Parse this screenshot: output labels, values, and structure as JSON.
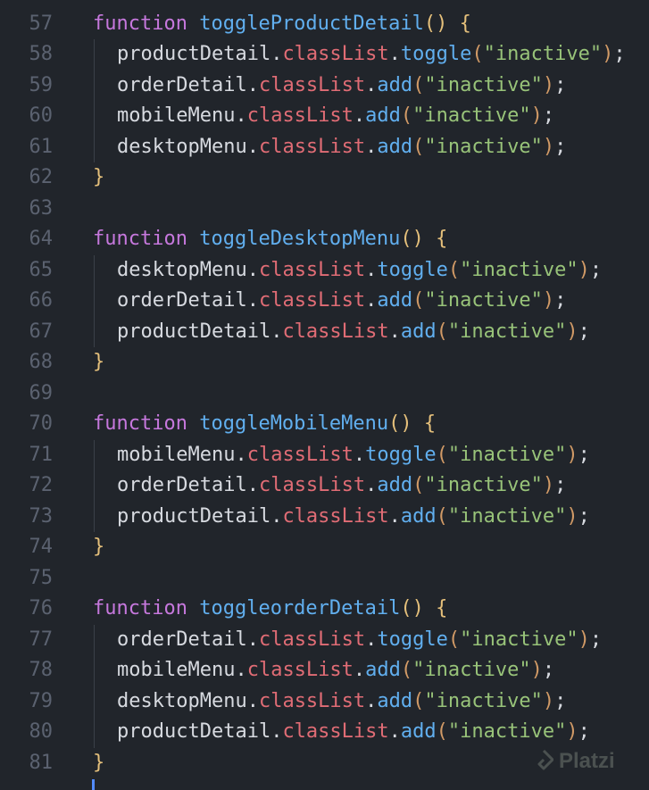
{
  "editor": {
    "lines": [
      {
        "n": "57",
        "indent": false,
        "tokens": [
          {
            "t": "kw",
            "v": "function"
          },
          {
            "t": "sp",
            "v": " "
          },
          {
            "t": "fn",
            "v": "toggleProductDetail"
          },
          {
            "t": "p1",
            "v": "()"
          },
          {
            "t": "sp",
            "v": " "
          },
          {
            "t": "p1",
            "v": "{"
          }
        ]
      },
      {
        "n": "58",
        "indent": true,
        "tokens": [
          {
            "t": "obj",
            "v": "productDetail"
          },
          {
            "t": "obj",
            "v": "."
          },
          {
            "t": "prop",
            "v": "classList"
          },
          {
            "t": "obj",
            "v": "."
          },
          {
            "t": "fn",
            "v": "toggle"
          },
          {
            "t": "p2",
            "v": "("
          },
          {
            "t": "str",
            "v": "\"inactive\""
          },
          {
            "t": "p2",
            "v": ")"
          },
          {
            "t": "obj",
            "v": ";"
          }
        ]
      },
      {
        "n": "59",
        "indent": true,
        "tokens": [
          {
            "t": "obj",
            "v": "orderDetail"
          },
          {
            "t": "obj",
            "v": "."
          },
          {
            "t": "prop",
            "v": "classList"
          },
          {
            "t": "obj",
            "v": "."
          },
          {
            "t": "fn",
            "v": "add"
          },
          {
            "t": "p2",
            "v": "("
          },
          {
            "t": "str",
            "v": "\"inactive\""
          },
          {
            "t": "p2",
            "v": ")"
          },
          {
            "t": "obj",
            "v": ";"
          }
        ]
      },
      {
        "n": "60",
        "indent": true,
        "tokens": [
          {
            "t": "obj",
            "v": "mobileMenu"
          },
          {
            "t": "obj",
            "v": "."
          },
          {
            "t": "prop",
            "v": "classList"
          },
          {
            "t": "obj",
            "v": "."
          },
          {
            "t": "fn",
            "v": "add"
          },
          {
            "t": "p2",
            "v": "("
          },
          {
            "t": "str",
            "v": "\"inactive\""
          },
          {
            "t": "p2",
            "v": ")"
          },
          {
            "t": "obj",
            "v": ";"
          }
        ]
      },
      {
        "n": "61",
        "indent": true,
        "tokens": [
          {
            "t": "obj",
            "v": "desktopMenu"
          },
          {
            "t": "obj",
            "v": "."
          },
          {
            "t": "prop",
            "v": "classList"
          },
          {
            "t": "obj",
            "v": "."
          },
          {
            "t": "fn",
            "v": "add"
          },
          {
            "t": "p2",
            "v": "("
          },
          {
            "t": "str",
            "v": "\"inactive\""
          },
          {
            "t": "p2",
            "v": ")"
          },
          {
            "t": "obj",
            "v": ";"
          }
        ]
      },
      {
        "n": "62",
        "indent": false,
        "tokens": [
          {
            "t": "p1",
            "v": "}"
          }
        ]
      },
      {
        "n": "63",
        "indent": false,
        "tokens": []
      },
      {
        "n": "64",
        "indent": false,
        "tokens": [
          {
            "t": "kw",
            "v": "function"
          },
          {
            "t": "sp",
            "v": " "
          },
          {
            "t": "fn",
            "v": "toggleDesktopMenu"
          },
          {
            "t": "p1",
            "v": "()"
          },
          {
            "t": "sp",
            "v": " "
          },
          {
            "t": "p1",
            "v": "{"
          }
        ]
      },
      {
        "n": "65",
        "indent": true,
        "tokens": [
          {
            "t": "obj",
            "v": "desktopMenu"
          },
          {
            "t": "obj",
            "v": "."
          },
          {
            "t": "prop",
            "v": "classList"
          },
          {
            "t": "obj",
            "v": "."
          },
          {
            "t": "fn",
            "v": "toggle"
          },
          {
            "t": "p2",
            "v": "("
          },
          {
            "t": "str",
            "v": "\"inactive\""
          },
          {
            "t": "p2",
            "v": ")"
          },
          {
            "t": "obj",
            "v": ";"
          }
        ]
      },
      {
        "n": "66",
        "indent": true,
        "tokens": [
          {
            "t": "obj",
            "v": "orderDetail"
          },
          {
            "t": "obj",
            "v": "."
          },
          {
            "t": "prop",
            "v": "classList"
          },
          {
            "t": "obj",
            "v": "."
          },
          {
            "t": "fn",
            "v": "add"
          },
          {
            "t": "p2",
            "v": "("
          },
          {
            "t": "str",
            "v": "\"inactive\""
          },
          {
            "t": "p2",
            "v": ")"
          },
          {
            "t": "obj",
            "v": ";"
          }
        ]
      },
      {
        "n": "67",
        "indent": true,
        "tokens": [
          {
            "t": "obj",
            "v": "productDetail"
          },
          {
            "t": "obj",
            "v": "."
          },
          {
            "t": "prop",
            "v": "classList"
          },
          {
            "t": "obj",
            "v": "."
          },
          {
            "t": "fn",
            "v": "add"
          },
          {
            "t": "p2",
            "v": "("
          },
          {
            "t": "str",
            "v": "\"inactive\""
          },
          {
            "t": "p2",
            "v": ")"
          },
          {
            "t": "obj",
            "v": ";"
          }
        ]
      },
      {
        "n": "68",
        "indent": false,
        "tokens": [
          {
            "t": "p1",
            "v": "}"
          }
        ]
      },
      {
        "n": "69",
        "indent": false,
        "tokens": []
      },
      {
        "n": "70",
        "indent": false,
        "tokens": [
          {
            "t": "kw",
            "v": "function"
          },
          {
            "t": "sp",
            "v": " "
          },
          {
            "t": "fn",
            "v": "toggleMobileMenu"
          },
          {
            "t": "p1",
            "v": "()"
          },
          {
            "t": "sp",
            "v": " "
          },
          {
            "t": "p1",
            "v": "{"
          }
        ]
      },
      {
        "n": "71",
        "indent": true,
        "tokens": [
          {
            "t": "obj",
            "v": "mobileMenu"
          },
          {
            "t": "obj",
            "v": "."
          },
          {
            "t": "prop",
            "v": "classList"
          },
          {
            "t": "obj",
            "v": "."
          },
          {
            "t": "fn",
            "v": "toggle"
          },
          {
            "t": "p2",
            "v": "("
          },
          {
            "t": "str",
            "v": "\"inactive\""
          },
          {
            "t": "p2",
            "v": ")"
          },
          {
            "t": "obj",
            "v": ";"
          }
        ]
      },
      {
        "n": "72",
        "indent": true,
        "tokens": [
          {
            "t": "obj",
            "v": "orderDetail"
          },
          {
            "t": "obj",
            "v": "."
          },
          {
            "t": "prop",
            "v": "classList"
          },
          {
            "t": "obj",
            "v": "."
          },
          {
            "t": "fn",
            "v": "add"
          },
          {
            "t": "p2",
            "v": "("
          },
          {
            "t": "str",
            "v": "\"inactive\""
          },
          {
            "t": "p2",
            "v": ")"
          },
          {
            "t": "obj",
            "v": ";"
          }
        ]
      },
      {
        "n": "73",
        "indent": true,
        "tokens": [
          {
            "t": "obj",
            "v": "productDetail"
          },
          {
            "t": "obj",
            "v": "."
          },
          {
            "t": "prop",
            "v": "classList"
          },
          {
            "t": "obj",
            "v": "."
          },
          {
            "t": "fn",
            "v": "add"
          },
          {
            "t": "p2",
            "v": "("
          },
          {
            "t": "str",
            "v": "\"inactive\""
          },
          {
            "t": "p2",
            "v": ")"
          },
          {
            "t": "obj",
            "v": ";"
          }
        ]
      },
      {
        "n": "74",
        "indent": false,
        "tokens": [
          {
            "t": "p1",
            "v": "}"
          }
        ]
      },
      {
        "n": "75",
        "indent": false,
        "tokens": []
      },
      {
        "n": "76",
        "indent": false,
        "tokens": [
          {
            "t": "kw",
            "v": "function"
          },
          {
            "t": "sp",
            "v": " "
          },
          {
            "t": "fn",
            "v": "toggleorderDetail"
          },
          {
            "t": "p1",
            "v": "()"
          },
          {
            "t": "sp",
            "v": " "
          },
          {
            "t": "p1",
            "v": "{"
          }
        ]
      },
      {
        "n": "77",
        "indent": true,
        "tokens": [
          {
            "t": "obj",
            "v": "orderDetail"
          },
          {
            "t": "obj",
            "v": "."
          },
          {
            "t": "prop",
            "v": "classList"
          },
          {
            "t": "obj",
            "v": "."
          },
          {
            "t": "fn",
            "v": "toggle"
          },
          {
            "t": "p2",
            "v": "("
          },
          {
            "t": "str",
            "v": "\"inactive\""
          },
          {
            "t": "p2",
            "v": ")"
          },
          {
            "t": "obj",
            "v": ";"
          }
        ]
      },
      {
        "n": "78",
        "indent": true,
        "tokens": [
          {
            "t": "obj",
            "v": "mobileMenu"
          },
          {
            "t": "obj",
            "v": "."
          },
          {
            "t": "prop",
            "v": "classList"
          },
          {
            "t": "obj",
            "v": "."
          },
          {
            "t": "fn",
            "v": "add"
          },
          {
            "t": "p2",
            "v": "("
          },
          {
            "t": "str",
            "v": "\"inactive\""
          },
          {
            "t": "p2",
            "v": ")"
          },
          {
            "t": "obj",
            "v": ";"
          }
        ]
      },
      {
        "n": "79",
        "indent": true,
        "tokens": [
          {
            "t": "obj",
            "v": "desktopMenu"
          },
          {
            "t": "obj",
            "v": "."
          },
          {
            "t": "prop",
            "v": "classList"
          },
          {
            "t": "obj",
            "v": "."
          },
          {
            "t": "fn",
            "v": "add"
          },
          {
            "t": "p2",
            "v": "("
          },
          {
            "t": "str",
            "v": "\"inactive\""
          },
          {
            "t": "p2",
            "v": ")"
          },
          {
            "t": "obj",
            "v": ";"
          }
        ]
      },
      {
        "n": "80",
        "indent": true,
        "tokens": [
          {
            "t": "obj",
            "v": "productDetail"
          },
          {
            "t": "obj",
            "v": "."
          },
          {
            "t": "prop",
            "v": "classList"
          },
          {
            "t": "obj",
            "v": "."
          },
          {
            "t": "fn",
            "v": "add"
          },
          {
            "t": "p2",
            "v": "("
          },
          {
            "t": "str",
            "v": "\"inactive\""
          },
          {
            "t": "p2",
            "v": ")"
          },
          {
            "t": "obj",
            "v": ";"
          }
        ]
      },
      {
        "n": "81",
        "indent": false,
        "tokens": [
          {
            "t": "p1",
            "v": "}"
          }
        ]
      }
    ]
  },
  "watermark": {
    "text": "Platzi",
    "icon": "platzi-logo-icon"
  },
  "colors": {
    "background": "#21252b",
    "line_number": "#5b6270",
    "keyword": "#c678dd",
    "function": "#61afef",
    "property": "#e06c75",
    "string": "#98c379",
    "plain": "#d7dae0",
    "bracket_outer": "#e5c07b",
    "bracket_inner": "#d19a66",
    "cursor": "#528bff"
  }
}
